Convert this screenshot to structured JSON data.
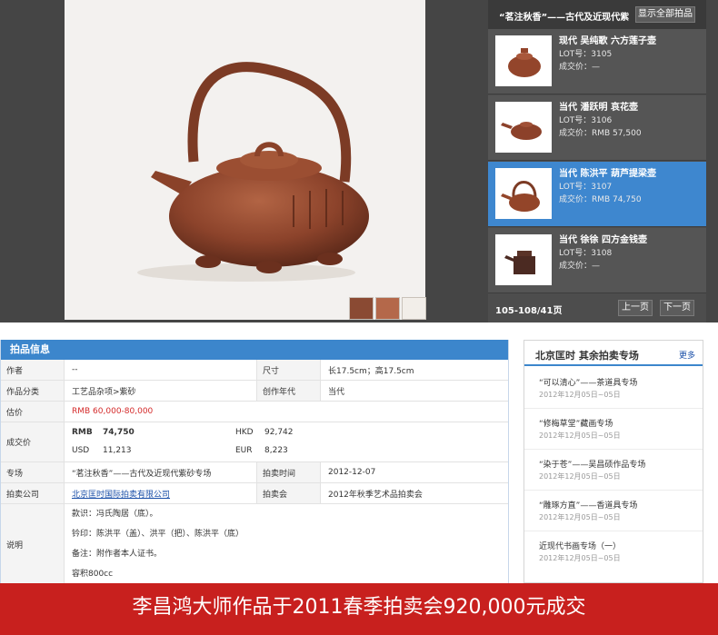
{
  "viewer": {
    "panel_title": "“茗注秋香”——古代及近现代紫",
    "show_all_label": "显示全部拍品",
    "lots": [
      {
        "name": "现代  吴纯歌  六方莲子壶",
        "lot": "LOT号：3105",
        "price": "成交价：—",
        "active": false
      },
      {
        "name": "当代  潘跃明  哀花壶",
        "lot": "LOT号：3106",
        "price": "成交价：RMB 57,500",
        "active": false
      },
      {
        "name": "当代  陈洪平  葫芦提梁壶",
        "lot": "LOT号：3107",
        "price": "成交价：RMB 74,750",
        "active": true
      },
      {
        "name": "当代  徐徐  四方金钱壶",
        "lot": "LOT号：3108",
        "price": "成交价：—",
        "active": false
      }
    ],
    "pager_info": "105-108/41页",
    "prev_label": "上一页",
    "next_label": "下一页"
  },
  "info": {
    "header": "拍品信息",
    "author_label": "作者",
    "author_value": "--",
    "size_label": "尺寸",
    "size_value": "长17.5cm；高17.5cm",
    "category_label": "作品分类",
    "category_value": "工艺品杂项>紫砂",
    "era_label": "创作年代",
    "era_value": "当代",
    "estimate_label": "估价",
    "estimate_value": "RMB   60,000-80,000",
    "deal_label": "成交价",
    "deal": {
      "rmb_cur": "RMB",
      "rmb_val": "74,750",
      "hkd_cur": "HKD",
      "hkd_val": "92,742",
      "usd_cur": "USD",
      "usd_val": "11,213",
      "eur_cur": "EUR",
      "eur_val": "8,223"
    },
    "session_label": "专场",
    "session_value": "“茗注秋香”——古代及近现代紫砂专场",
    "time_label": "拍卖时间",
    "time_value": "2012-12-07",
    "company_label": "拍卖公司",
    "company_value": "北京匡时国际拍卖有限公司",
    "auction_label": "拍卖会",
    "auction_value": "2012年秋季艺术品拍卖会",
    "desc_label": "说明",
    "desc_lines": [
      "款识：冯氏陶居（底）。",
      "钤印：陈洪平（盖）、洪平（把）、陈洪平（底）",
      "备注：附作者本人证书。",
      "容积800cc"
    ]
  },
  "sidebar": {
    "title": "北京匡时  其余拍卖专场",
    "more": "更多",
    "items": [
      {
        "title": "“可以清心”——茶道具专场",
        "date": "2012年12月05日~05日"
      },
      {
        "title": "“修梅草堂”藏画专场",
        "date": "2012年12月05日~05日"
      },
      {
        "title": "“染于苍”——吴昌硕作品专场",
        "date": "2012年12月05日~05日"
      },
      {
        "title": "“雕琢方直”——香道具专场",
        "date": "2012年12月05日~05日"
      },
      {
        "title": "近现代书画专场（一）",
        "date": "2012年12月05日~05日"
      }
    ]
  },
  "banner": "李昌鸿大师作品于2011春季拍卖会920,000元成交",
  "colors": {
    "accent": "#3c86cc",
    "banner": "#c8201e",
    "viewer_bg": "#454545",
    "estimate": "#d42a2a"
  }
}
